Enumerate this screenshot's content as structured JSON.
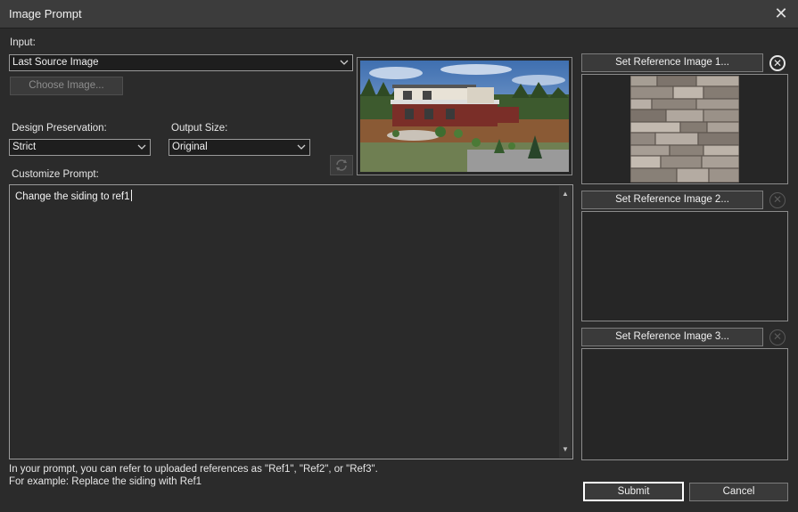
{
  "window": {
    "title": "Image Prompt",
    "close_glyph": "✕"
  },
  "input": {
    "label": "Input:",
    "source_value": "Last Source Image",
    "choose_button": "Choose Image..."
  },
  "design_preservation": {
    "label": "Design Preservation:",
    "value": "Strict"
  },
  "output_size": {
    "label": "Output Size:",
    "value": "Original"
  },
  "prompt": {
    "label": "Customize Prompt:",
    "text": "Change the siding to ref1"
  },
  "references": [
    {
      "button": "Set Reference Image 1...",
      "has_image": true
    },
    {
      "button": "Set Reference Image 2...",
      "has_image": false
    },
    {
      "button": "Set Reference Image 3...",
      "has_image": false
    }
  ],
  "help": {
    "line1": "In your prompt, you can refer to uploaded references as \"Ref1\", \"Ref2\", or \"Ref3\".",
    "line2": "For example: Replace the siding with Ref1"
  },
  "actions": {
    "submit": "Submit",
    "cancel": "Cancel"
  },
  "icons": {
    "dropdown": "chevron-down-icon",
    "refresh": "refresh-icon",
    "remove": "close-circle-icon"
  },
  "colors": {
    "background": "#2b2b2b",
    "titlebar": "#3c3c3c",
    "accent_border": "#ffffff"
  }
}
